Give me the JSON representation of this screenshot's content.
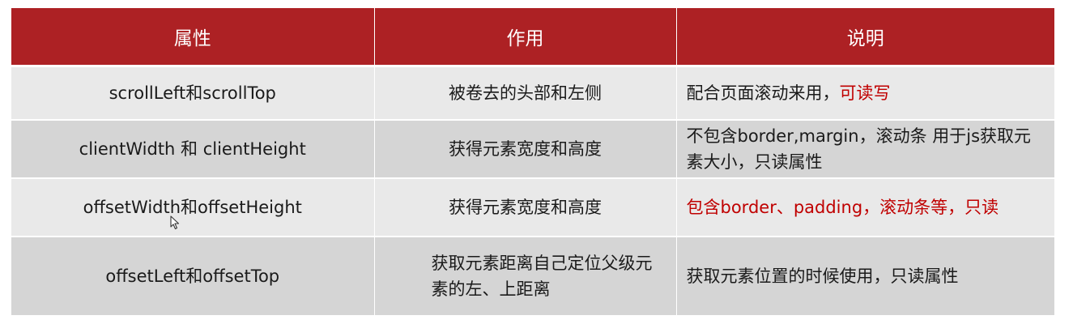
{
  "table": {
    "headers": [
      "属性",
      "作用",
      "说明"
    ],
    "rows": [
      {
        "property": "scrollLeft和scrollTop",
        "purpose": "被卷去的头部和左侧",
        "note_normal": "配合页面滚动来用，",
        "note_highlight": "可读写"
      },
      {
        "property": "clientWidth 和 clientHeight",
        "purpose": "获得元素宽度和高度",
        "note_normal": "不包含border,margin，滚动条 用于js获取元素大小，只读属性"
      },
      {
        "property": "offsetWidth和offsetHeight",
        "purpose": "获得元素宽度和高度",
        "note_highlight": "包含border、padding，滚动条等，只读"
      },
      {
        "property": "offsetLeft和offsetTop",
        "purpose": "获取元素距离自己定位父级元素的左、上距离",
        "note_normal": "获取元素位置的时候使用，只读属性"
      }
    ]
  },
  "colors": {
    "header_bg": "#ad2124",
    "header_text": "#ffffff",
    "row_light": "#e9e9e9",
    "row_dark": "#d5d5d5",
    "highlight_red": "#c00000"
  },
  "icons": {
    "cursor": "mouse-pointer-icon"
  }
}
